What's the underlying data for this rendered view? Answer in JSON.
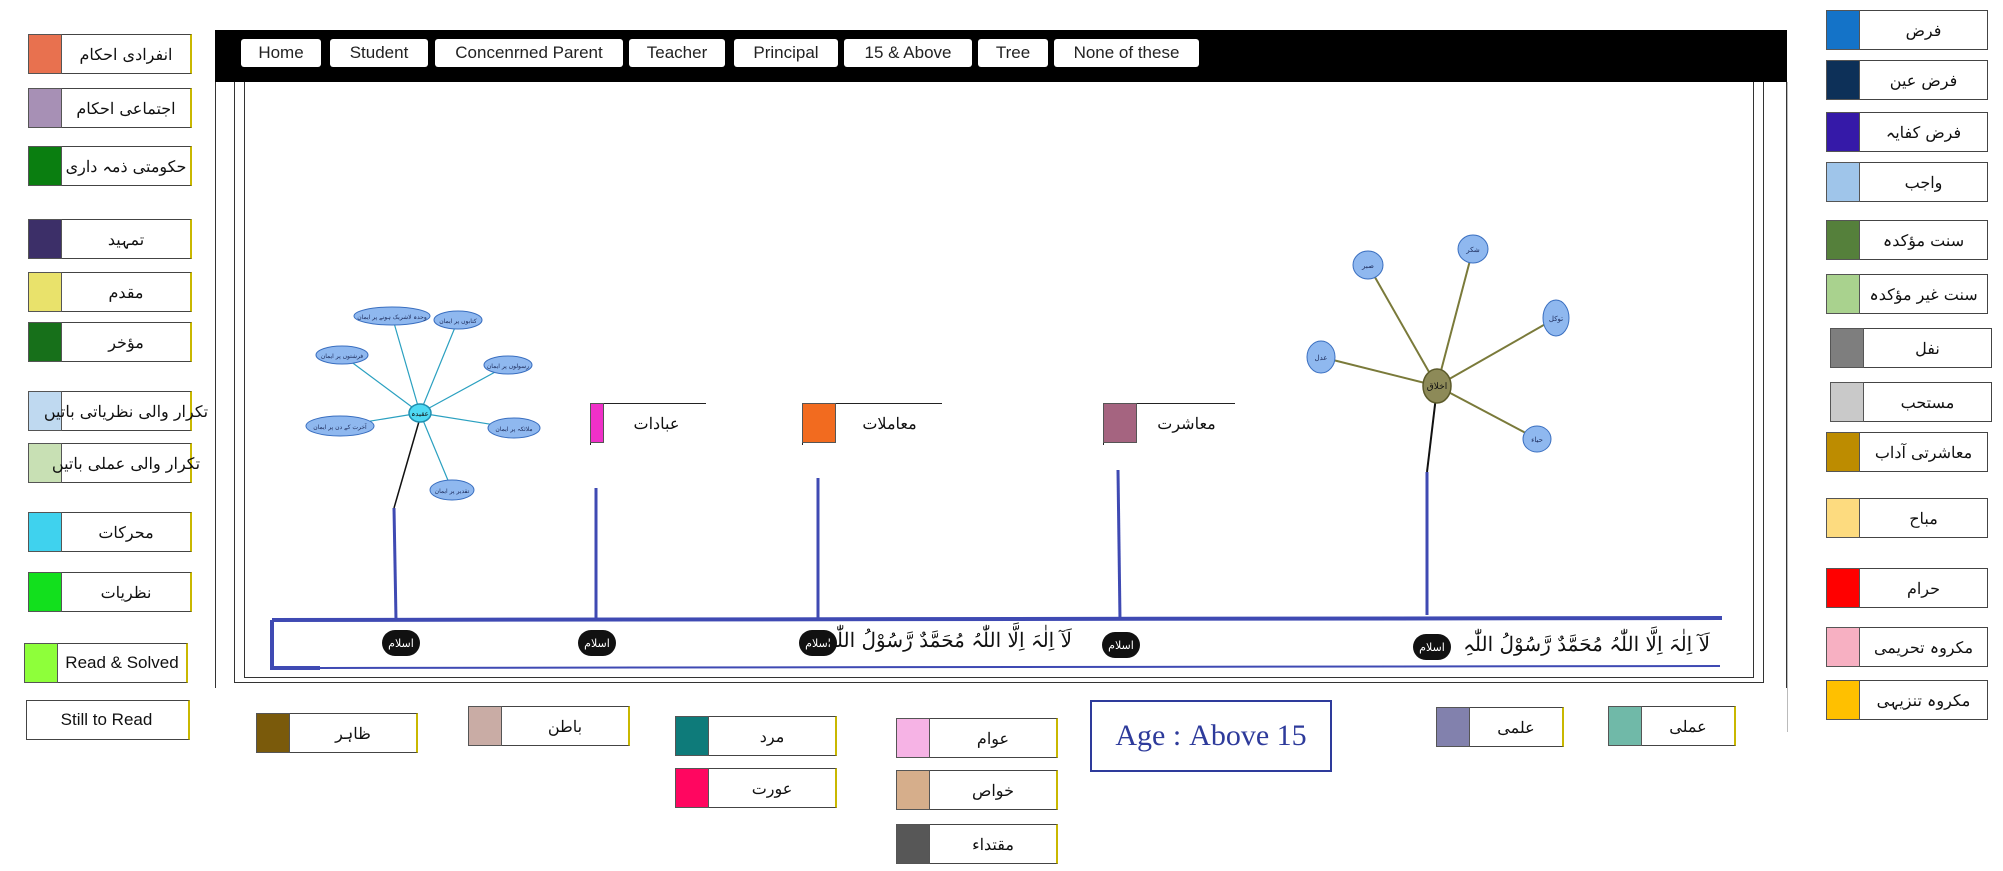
{
  "nav": [
    "Home",
    "Student",
    "Concenrned Parent",
    "Teacher",
    "Principal",
    "15 & Above",
    "Tree",
    "None of these"
  ],
  "left_legend": [
    {
      "label": "انفرادی احکام",
      "color": "#e8714f"
    },
    {
      "label": "اجتماعی احکام",
      "color": "#a790b5"
    },
    {
      "label": "حکومتی ذمہ داری",
      "color": "#0a7e10"
    },
    {
      "label": "تمہید",
      "color": "#3c2f68"
    },
    {
      "label": "مقدم",
      "color": "#e9e26b"
    },
    {
      "label": "مؤخر",
      "color": "#17701a"
    },
    {
      "label": "تکرار والی نظریاتی باتیں",
      "color": "#bfd9f0"
    },
    {
      "label": "تکرار والی عملی باتیں",
      "color": "#c8e0b4"
    },
    {
      "label": "محرکات",
      "color": "#3fd2ee"
    },
    {
      "label": "نظریات",
      "color": "#12e01d"
    },
    {
      "label": "Read & Solved",
      "color": "#8eff3a"
    },
    {
      "label": "Still to Read",
      "color": ""
    }
  ],
  "right_legend": [
    {
      "label": "فرض",
      "color": "#1473c8"
    },
    {
      "label": "فرض عین",
      "color": "#0d3058"
    },
    {
      "label": "فرض کفایہ",
      "color": "#3519a8"
    },
    {
      "label": "واجب",
      "color": "#9fc5ea"
    },
    {
      "label": "سنت مؤکدہ",
      "color": "#55803b"
    },
    {
      "label": "سنت غیر مؤکدہ",
      "color": "#a9d28e"
    },
    {
      "label": "نفل",
      "color": "#7e7e7e"
    },
    {
      "label": "مستحب",
      "color": "#c9c9c9"
    },
    {
      "label": "معاشرتی آداب",
      "color": "#bd8c00"
    },
    {
      "label": "مباح",
      "color": "#fddb7f"
    },
    {
      "label": "حرام",
      "color": "#ff0000"
    },
    {
      "label": "مکروہ تحریمی",
      "color": "#f7b0c2"
    },
    {
      "label": "مکروہ تنزیہی",
      "color": "#ffc000"
    }
  ],
  "bottom_legend": [
    {
      "label": "ظاہر",
      "color": "#7a5a0b"
    },
    {
      "label": "باطن",
      "color": "#c9aca5"
    },
    {
      "label": "مرد",
      "color": "#0e7b7a"
    },
    {
      "label": "عورت",
      "color": "#ff0660"
    },
    {
      "label": "عوام",
      "color": "#f6b3e5"
    },
    {
      "label": "خواص",
      "color": "#d6ae8b"
    },
    {
      "label": "مقتداء",
      "color": "#575757"
    },
    {
      "label": "علمی",
      "color": "#8281ad"
    },
    {
      "label": "عملی",
      "color": "#70b9a8"
    }
  ],
  "branches": [
    {
      "label": "عبادات",
      "color": "#f030c8"
    },
    {
      "label": "معاملات",
      "color": "#f26b1f"
    },
    {
      "label": "معاشرت",
      "color": "#a56480"
    }
  ],
  "kalima": "لَآ اِلٰہَ اِلَّا اللّٰہُ مُحَمَّدٌ رَّسُوْلُ اللّٰہِ",
  "islam_label": "اسلام",
  "age": {
    "prefix": "Age :",
    "value": "Above 15"
  },
  "tree_left": {
    "center": "عقیدہ",
    "leaves": [
      "وحدہ لاشریک ہونے پر ایمان",
      "کتابوں پر ایمان",
      "رسولوں پر ایمان",
      "ملائکہ پر ایمان",
      "تقدیر پر ایمان",
      "آخرت کے دن پر ایمان",
      "فرشتوں پر ایمان"
    ]
  },
  "tree_right": {
    "center": "اخلاق",
    "leaves": [
      "صبر",
      "شکر",
      "توکل",
      "حیاء",
      "عدل"
    ]
  }
}
